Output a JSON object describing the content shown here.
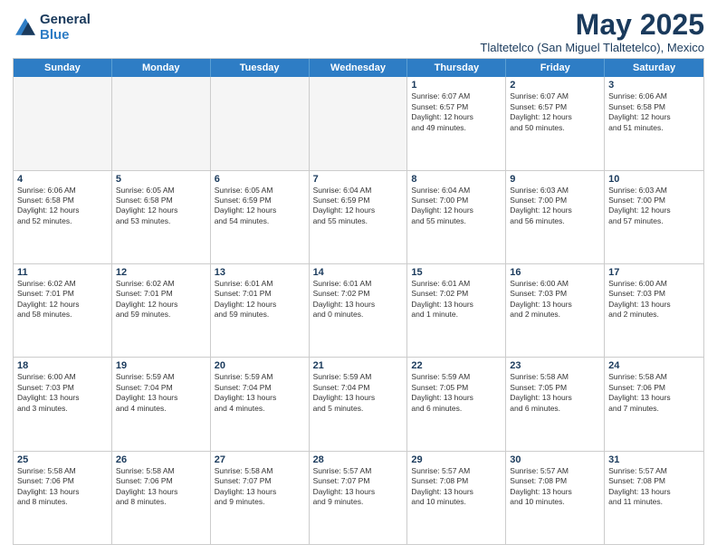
{
  "logo": {
    "general": "General",
    "blue": "Blue"
  },
  "title": "May 2025",
  "subtitle": "Tlaltetelco (San Miguel Tlaltetelco), Mexico",
  "weekdays": [
    "Sunday",
    "Monday",
    "Tuesday",
    "Wednesday",
    "Thursday",
    "Friday",
    "Saturday"
  ],
  "weeks": [
    [
      {
        "day": "",
        "text": ""
      },
      {
        "day": "",
        "text": ""
      },
      {
        "day": "",
        "text": ""
      },
      {
        "day": "",
        "text": ""
      },
      {
        "day": "1",
        "text": "Sunrise: 6:07 AM\nSunset: 6:57 PM\nDaylight: 12 hours\nand 49 minutes."
      },
      {
        "day": "2",
        "text": "Sunrise: 6:07 AM\nSunset: 6:57 PM\nDaylight: 12 hours\nand 50 minutes."
      },
      {
        "day": "3",
        "text": "Sunrise: 6:06 AM\nSunset: 6:58 PM\nDaylight: 12 hours\nand 51 minutes."
      }
    ],
    [
      {
        "day": "4",
        "text": "Sunrise: 6:06 AM\nSunset: 6:58 PM\nDaylight: 12 hours\nand 52 minutes."
      },
      {
        "day": "5",
        "text": "Sunrise: 6:05 AM\nSunset: 6:58 PM\nDaylight: 12 hours\nand 53 minutes."
      },
      {
        "day": "6",
        "text": "Sunrise: 6:05 AM\nSunset: 6:59 PM\nDaylight: 12 hours\nand 54 minutes."
      },
      {
        "day": "7",
        "text": "Sunrise: 6:04 AM\nSunset: 6:59 PM\nDaylight: 12 hours\nand 55 minutes."
      },
      {
        "day": "8",
        "text": "Sunrise: 6:04 AM\nSunset: 7:00 PM\nDaylight: 12 hours\nand 55 minutes."
      },
      {
        "day": "9",
        "text": "Sunrise: 6:03 AM\nSunset: 7:00 PM\nDaylight: 12 hours\nand 56 minutes."
      },
      {
        "day": "10",
        "text": "Sunrise: 6:03 AM\nSunset: 7:00 PM\nDaylight: 12 hours\nand 57 minutes."
      }
    ],
    [
      {
        "day": "11",
        "text": "Sunrise: 6:02 AM\nSunset: 7:01 PM\nDaylight: 12 hours\nand 58 minutes."
      },
      {
        "day": "12",
        "text": "Sunrise: 6:02 AM\nSunset: 7:01 PM\nDaylight: 12 hours\nand 59 minutes."
      },
      {
        "day": "13",
        "text": "Sunrise: 6:01 AM\nSunset: 7:01 PM\nDaylight: 12 hours\nand 59 minutes."
      },
      {
        "day": "14",
        "text": "Sunrise: 6:01 AM\nSunset: 7:02 PM\nDaylight: 13 hours\nand 0 minutes."
      },
      {
        "day": "15",
        "text": "Sunrise: 6:01 AM\nSunset: 7:02 PM\nDaylight: 13 hours\nand 1 minute."
      },
      {
        "day": "16",
        "text": "Sunrise: 6:00 AM\nSunset: 7:03 PM\nDaylight: 13 hours\nand 2 minutes."
      },
      {
        "day": "17",
        "text": "Sunrise: 6:00 AM\nSunset: 7:03 PM\nDaylight: 13 hours\nand 2 minutes."
      }
    ],
    [
      {
        "day": "18",
        "text": "Sunrise: 6:00 AM\nSunset: 7:03 PM\nDaylight: 13 hours\nand 3 minutes."
      },
      {
        "day": "19",
        "text": "Sunrise: 5:59 AM\nSunset: 7:04 PM\nDaylight: 13 hours\nand 4 minutes."
      },
      {
        "day": "20",
        "text": "Sunrise: 5:59 AM\nSunset: 7:04 PM\nDaylight: 13 hours\nand 4 minutes."
      },
      {
        "day": "21",
        "text": "Sunrise: 5:59 AM\nSunset: 7:04 PM\nDaylight: 13 hours\nand 5 minutes."
      },
      {
        "day": "22",
        "text": "Sunrise: 5:59 AM\nSunset: 7:05 PM\nDaylight: 13 hours\nand 6 minutes."
      },
      {
        "day": "23",
        "text": "Sunrise: 5:58 AM\nSunset: 7:05 PM\nDaylight: 13 hours\nand 6 minutes."
      },
      {
        "day": "24",
        "text": "Sunrise: 5:58 AM\nSunset: 7:06 PM\nDaylight: 13 hours\nand 7 minutes."
      }
    ],
    [
      {
        "day": "25",
        "text": "Sunrise: 5:58 AM\nSunset: 7:06 PM\nDaylight: 13 hours\nand 8 minutes."
      },
      {
        "day": "26",
        "text": "Sunrise: 5:58 AM\nSunset: 7:06 PM\nDaylight: 13 hours\nand 8 minutes."
      },
      {
        "day": "27",
        "text": "Sunrise: 5:58 AM\nSunset: 7:07 PM\nDaylight: 13 hours\nand 9 minutes."
      },
      {
        "day": "28",
        "text": "Sunrise: 5:57 AM\nSunset: 7:07 PM\nDaylight: 13 hours\nand 9 minutes."
      },
      {
        "day": "29",
        "text": "Sunrise: 5:57 AM\nSunset: 7:08 PM\nDaylight: 13 hours\nand 10 minutes."
      },
      {
        "day": "30",
        "text": "Sunrise: 5:57 AM\nSunset: 7:08 PM\nDaylight: 13 hours\nand 10 minutes."
      },
      {
        "day": "31",
        "text": "Sunrise: 5:57 AM\nSunset: 7:08 PM\nDaylight: 13 hours\nand 11 minutes."
      }
    ]
  ]
}
